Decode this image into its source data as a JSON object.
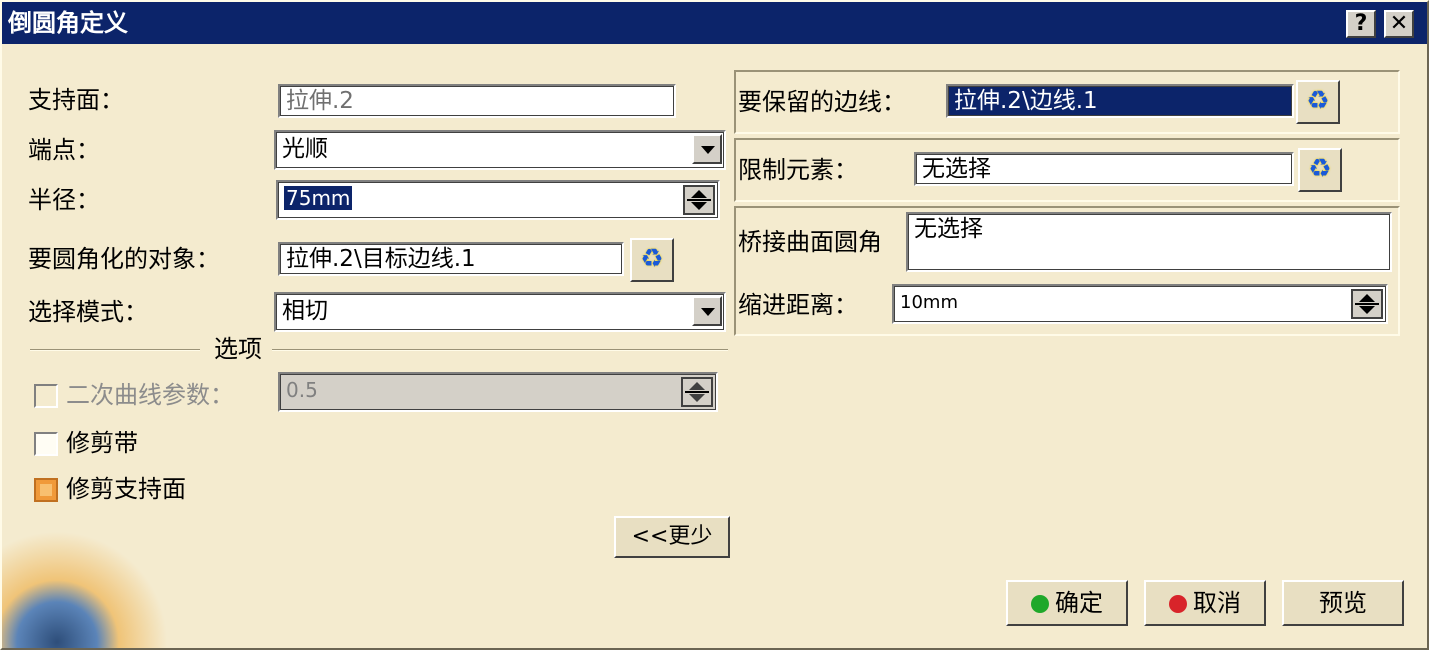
{
  "window": {
    "title": "倒圆角定义",
    "help_label": "?",
    "close_label": "✕"
  },
  "left": {
    "support_label": "支持面：",
    "support_value": "拉伸.2",
    "endpoint_label": "端点：",
    "endpoint_value": "光顺",
    "radius_label": "半径：",
    "radius_value": "75mm",
    "objects_label": "要圆角化的对象：",
    "objects_value": "拉伸.2\\目标边线.1",
    "mode_label": "选择模式：",
    "mode_value": "相切",
    "options_label": "选项",
    "conic_label": "二次曲线参数：",
    "conic_value": "0.5",
    "conic_checked": false,
    "trim_ribbon_label": "修剪带",
    "trim_ribbon_checked": false,
    "trim_support_label": "修剪支持面",
    "trim_support_checked": true,
    "less_button": "<<更少"
  },
  "right": {
    "keep_edges_label": "要保留的边线：",
    "keep_edges_value": "拉伸.2\\边线.1",
    "limit_label": "限制元素：",
    "limit_value": "无选择",
    "blend_label": "桥接曲面圆角",
    "blend_value": "无选择",
    "setback_label": "缩进距离：",
    "setback_value": "10mm"
  },
  "footer": {
    "ok": "确定",
    "cancel": "取消",
    "preview": "预览",
    "ok_color": "#1fa82a",
    "cancel_color": "#d8242a"
  },
  "icons": {
    "pick_icon": "selection-picker-icon",
    "ok_icon": "green-dot-icon",
    "cancel_icon": "red-dot-icon"
  }
}
